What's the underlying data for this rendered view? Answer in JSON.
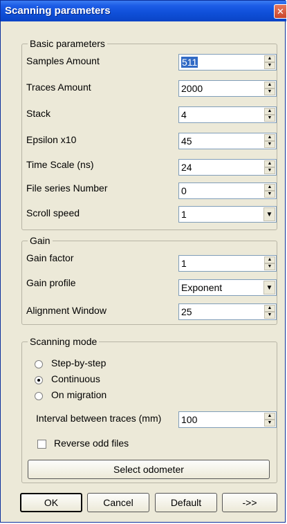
{
  "window": {
    "title": "Scanning parameters",
    "close_glyph": "✕"
  },
  "basic": {
    "legend": "Basic parameters",
    "fields": [
      {
        "label": "Samples Amount",
        "value": "511"
      },
      {
        "label": "Traces Amount",
        "value": "2000"
      },
      {
        "label": "Stack",
        "value": "4"
      },
      {
        "label": "Epsilon x10",
        "value": "45"
      },
      {
        "label": "Time Scale (ns)",
        "value": "24"
      },
      {
        "label": "File series Number",
        "value": "0"
      }
    ],
    "scroll_speed": {
      "label": "Scroll speed",
      "value": "1"
    }
  },
  "gain": {
    "legend": "Gain",
    "factor": {
      "label": "Gain factor",
      "value": "1"
    },
    "profile": {
      "label": "Gain profile",
      "value": "Exponent"
    },
    "alignment": {
      "label": "Alignment Window",
      "value": "25"
    }
  },
  "mode": {
    "legend": "Scanning mode",
    "options": [
      {
        "label": "Step-by-step",
        "selected": false
      },
      {
        "label": "Continuous",
        "selected": true
      },
      {
        "label": "On migration",
        "selected": false
      }
    ],
    "interval": {
      "label": "Interval between traces (mm)",
      "value": "100"
    },
    "reverse_odd": {
      "label": "Reverse odd files",
      "checked": false
    },
    "odometer_button": "Select odometer"
  },
  "buttons": {
    "ok": "OK",
    "cancel": "Cancel",
    "default": "Default",
    "more": "->>"
  },
  "icons": {
    "spin_up": "▲",
    "spin_down": "▼",
    "combo_arrow": "▼"
  }
}
